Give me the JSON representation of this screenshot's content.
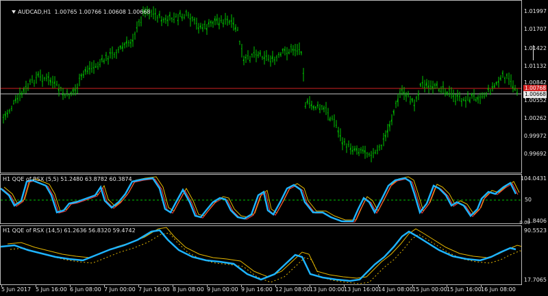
{
  "main": {
    "header_icon": "triangle-down-icon",
    "title": "AUDCAD,H1  1.00765 1.00766 1.00608 1.00668",
    "price_labels": [
      "1.01997",
      "1.01707",
      "1.01422",
      "1.01132",
      "1.00842",
      "1.00552",
      "1.00262",
      "0.99972",
      "0.99692"
    ],
    "red_line_label": "1.00768",
    "current_price_label": "1.00668",
    "colors": {
      "candles": "#00c800",
      "red_line": "#d22222",
      "price_line": "#c8c8c8",
      "background": "#000000"
    }
  },
  "indicator1": {
    "title": "H1 QQE of RSX (5,5) 51.2480 63.8782 60.3874",
    "axis_labels": [
      "104.0431",
      "50",
      "-1.8406"
    ],
    "colors": {
      "main": "#1eb4ff",
      "fast": "#ff4040",
      "slow": "#e6b800",
      "level": "#00c800"
    }
  },
  "indicator2": {
    "title": "H1 QQE of RSX (14,5) 61.2636 56.8320 59.4742",
    "axis_labels": [
      "90.5523",
      "17.7065"
    ],
    "colors": {
      "main": "#1eb4ff",
      "slow": "#e6b800",
      "dots": "#e6b800"
    }
  },
  "time_axis": {
    "labels": [
      "5 Jun 2017",
      "5 Jun 16:00",
      "6 Jun 08:00",
      "7 Jun 00:00",
      "7 Jun 16:00",
      "8 Jun 08:00",
      "9 Jun 00:00",
      "9 Jun 16:00",
      "12 Jun 08:00",
      "13 Jun 00:00",
      "13 Jun 16:00",
      "14 Jun 08:00",
      "15 Jun 00:00",
      "15 Jun 16:00",
      "16 Jun 08:00"
    ]
  },
  "extra_labels": {
    "odd_axis": "0.00"
  }
}
